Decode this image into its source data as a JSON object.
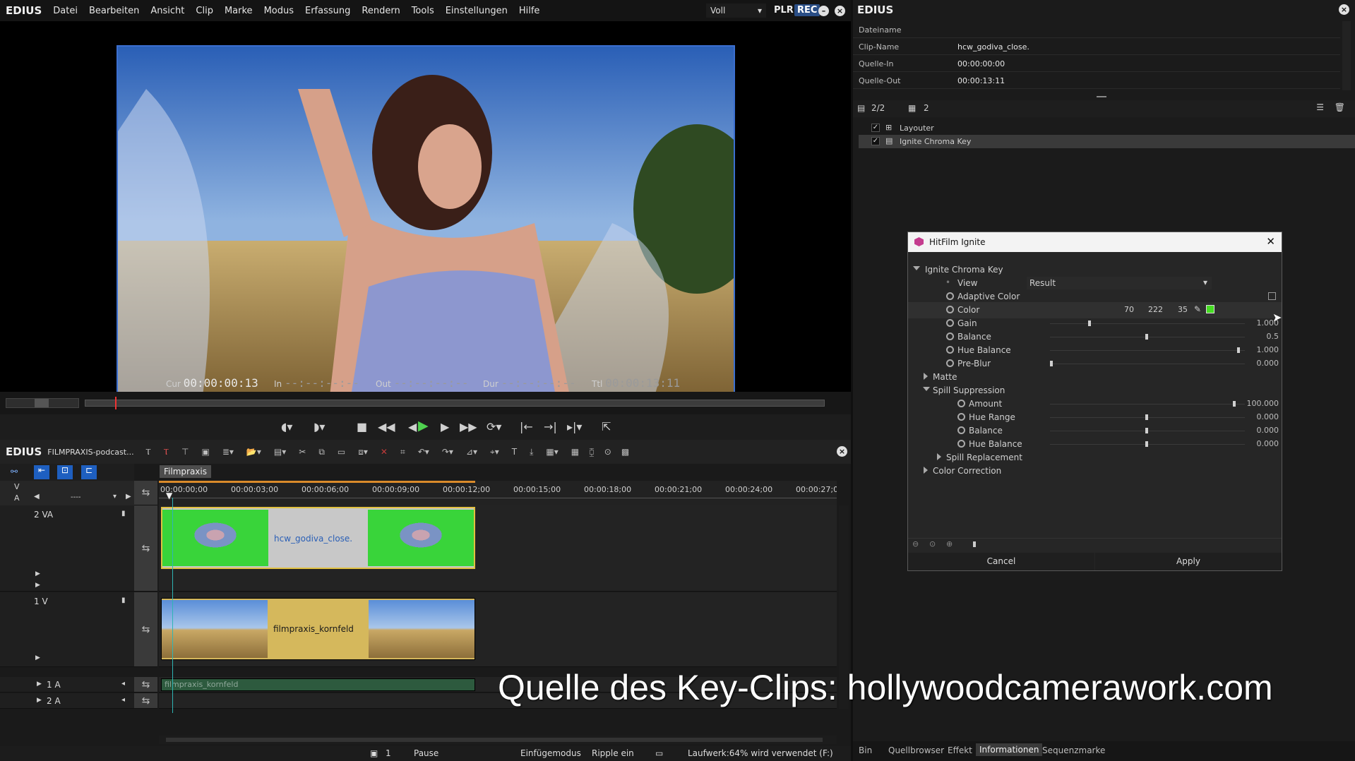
{
  "menubar": {
    "brand": "EDIUS",
    "items": [
      "Datei",
      "Bearbeiten",
      "Ansicht",
      "Clip",
      "Marke",
      "Modus",
      "Erfassung",
      "Rendern",
      "Tools",
      "Einstellungen",
      "Hilfe"
    ],
    "view_mode": "Voll",
    "plr": "PLR",
    "rec": "REC"
  },
  "monitor": {
    "cur_label": "Cur",
    "cur_value": "00:00:00:13",
    "in_label": "In",
    "in_value": "--:--:--:--",
    "out_label": "Out",
    "out_value": "--:--:--:--",
    "dur_label": "Dur",
    "dur_value": "--:--:--:--",
    "ttl_label": "Ttl",
    "ttl_value": "00:00:13:11",
    "playhead_fraction": 0.04
  },
  "timeline": {
    "brand": "EDIUS",
    "project": "FILMPRAXIS-podcast...",
    "sequence_tab": "Filmpraxis",
    "ruler": [
      "00:00:00;00",
      "00:00:03;00",
      "00:00:06;00",
      "00:00:09;00",
      "00:00:12;00",
      "00:00:15;00",
      "00:00:18;00",
      "00:00:21;00",
      "00:00:24;00",
      "00:00:27;0"
    ],
    "v_label": "V",
    "a_label": "A",
    "a_selector": "----",
    "tracks": [
      {
        "name": "2 VA",
        "clip": "hcw_godiva_close."
      },
      {
        "name": "1 V",
        "clip": "filmpraxis_kornfeld"
      },
      {
        "name": "1 A",
        "clip": "filmpraxis_kornfeld"
      },
      {
        "name": "2 A",
        "clip": ""
      }
    ]
  },
  "statusbar": {
    "page": "1",
    "state": "Pause",
    "mode": "Einfügemodus",
    "ripple": "Ripple ein",
    "drive": "Laufwerk:64% wird verwendet (F:)"
  },
  "info_panel": {
    "title": "EDIUS",
    "rows": [
      {
        "key": "Dateiname",
        "value": ""
      },
      {
        "key": "Clip-Name",
        "value": "hcw_godiva_close."
      },
      {
        "key": "Quelle-In",
        "value": "00:00:00:00"
      },
      {
        "key": "Quelle-Out",
        "value": "00:00:13:11"
      }
    ],
    "layer_count": "2/2",
    "filter_count": "2",
    "effects": [
      "Layouter",
      "Ignite Chroma Key"
    ],
    "tabs": [
      "Bin",
      "Quellbrowser",
      "Effekt",
      "Informationen",
      "Sequenzmarke"
    ],
    "active_tab": "Informationen"
  },
  "dialog": {
    "title": "HitFilm Ignite",
    "section": "Ignite Chroma Key",
    "view_label": "View",
    "view_value": "Result",
    "adaptive_color": "Adaptive Color",
    "color_label": "Color",
    "color_r": "70",
    "color_g": "222",
    "color_b": "35",
    "key_color": "#46de23",
    "params": [
      {
        "name": "Gain",
        "value": "1.000",
        "level": 0.2
      },
      {
        "name": "Balance",
        "value": "0.5",
        "level": 0.5
      },
      {
        "name": "Hue Balance",
        "value": "1.000",
        "level": 0.98
      },
      {
        "name": "Pre-Blur",
        "value": "0.000",
        "level": 0.0
      }
    ],
    "matte": "Matte",
    "spill": "Spill Suppression",
    "spill_params": [
      {
        "name": "Amount",
        "value": "100.000",
        "level": 0.96
      },
      {
        "name": "Hue Range",
        "value": "0.000",
        "level": 0.5
      },
      {
        "name": "Balance",
        "value": "0.000",
        "level": 0.5
      },
      {
        "name": "Hue Balance",
        "value": "0.000",
        "level": 0.5
      }
    ],
    "spill_replacement": "Spill Replacement",
    "color_correction": "Color Correction",
    "cancel": "Cancel",
    "apply": "Apply"
  },
  "caption": "Quelle des Key-Clips: hollywoodcamerawork.com"
}
